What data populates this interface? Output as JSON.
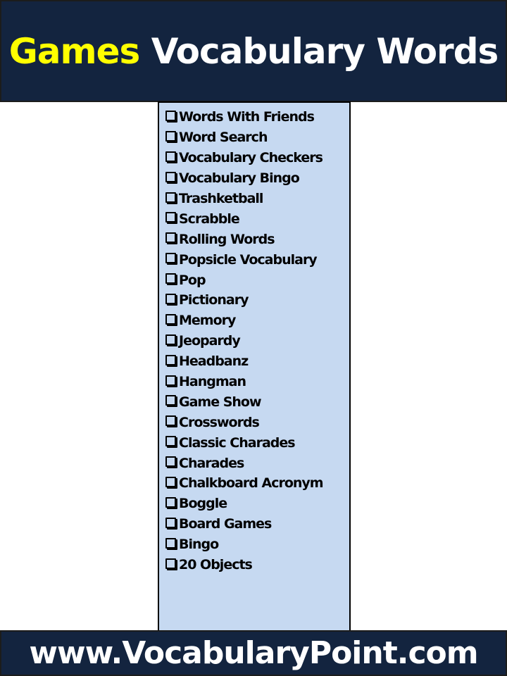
{
  "header": {
    "title_accent": "Games",
    "title_rest": " Vocabulary Words",
    "accent_color": "#ffff00",
    "background_color": "#13243f"
  },
  "list": {
    "background_color": "#c6d9f1",
    "checkbox_icon": "checkbox-empty-icon",
    "items": [
      "Words With Friends",
      "Word Search",
      "Vocabulary Checkers",
      "Vocabulary Bingo",
      "Trashketball",
      "Scrabble",
      "Rolling Words",
      "Popsicle Vocabulary",
      "Pop",
      "Pictionary",
      "Memory",
      "Jeopardy",
      "Headbanz",
      "Hangman",
      "Game Show",
      "Crosswords",
      "Classic Charades",
      "Charades",
      "Chalkboard Acronym",
      "Boggle",
      "Board Games",
      "Bingo",
      "20 Objects"
    ]
  },
  "footer": {
    "url": "www.VocabularyPoint.com"
  }
}
